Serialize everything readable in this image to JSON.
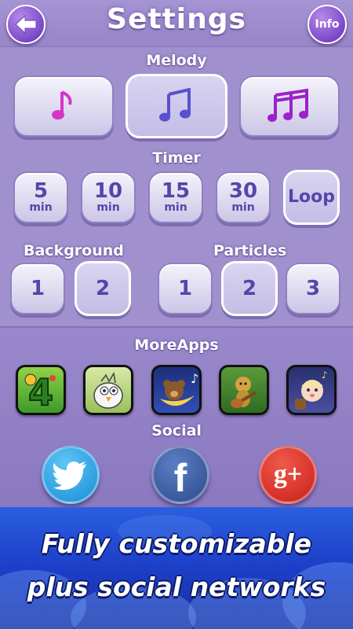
{
  "header": {
    "title": "Settings",
    "back_icon": "arrow-left-icon",
    "info_label": "Info"
  },
  "melody": {
    "label": "Melody",
    "options": [
      {
        "icon": "single-note-icon",
        "color": "#d534c8"
      },
      {
        "icon": "eighth-notes-icon",
        "color": "#5a4fd0",
        "selected": true
      },
      {
        "icon": "sixteenth-notes-icon",
        "color": "#9a22c9"
      }
    ]
  },
  "timer": {
    "label": "Timer",
    "options": [
      {
        "value": "5",
        "unit": "min"
      },
      {
        "value": "10",
        "unit": "min"
      },
      {
        "value": "15",
        "unit": "min"
      },
      {
        "value": "30",
        "unit": "min"
      },
      {
        "value": "Loop",
        "unit": "",
        "selected": true
      }
    ]
  },
  "background": {
    "label": "Background",
    "options": [
      "1",
      "2"
    ],
    "selected": "2"
  },
  "particles": {
    "label": "Particles",
    "options": [
      "1",
      "2",
      "3"
    ],
    "selected": "2"
  },
  "more_apps": {
    "label": "MoreApps",
    "apps": [
      {
        "icon": "number-four-dragon-app-icon"
      },
      {
        "icon": "cartoon-bird-app-icon"
      },
      {
        "icon": "sleeping-bear-moon-app-icon"
      },
      {
        "icon": "forest-monkey-guitar-app-icon"
      },
      {
        "icon": "baby-lullaby-app-icon"
      }
    ]
  },
  "social": {
    "label": "Social",
    "networks": [
      {
        "icon": "twitter-icon",
        "color": "#2fa7e6"
      },
      {
        "icon": "facebook-icon",
        "color": "#3b5a9e",
        "glyph": "f"
      },
      {
        "icon": "google-plus-icon",
        "color": "#d4302a",
        "glyph": "g+"
      }
    ]
  },
  "promo": {
    "line1": "Fully customizable",
    "line2": "plus social networks"
  }
}
